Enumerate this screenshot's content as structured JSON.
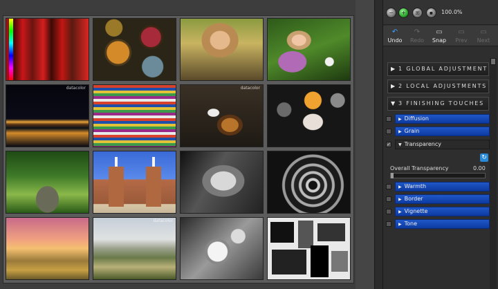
{
  "zoom": {
    "level": "100.0%"
  },
  "toolbar": {
    "undo": "Undo",
    "redo": "Redo",
    "snap": "Snap",
    "prev": "Prev",
    "next": "Next"
  },
  "sections": {
    "global": {
      "number": "1",
      "title": "GLOBAL ADJUSTMENT"
    },
    "local": {
      "number": "2",
      "title": "LOCAL ADJUSTMENTS"
    },
    "finishing": {
      "number": "3",
      "title": "FINISHING TOUCHES"
    }
  },
  "finishing_items": {
    "diffusion": "Diffusion",
    "grain": "Grain",
    "transparency": "Transparency",
    "warmth": "Warmth",
    "border": "Border",
    "vignette": "Vignette",
    "tone": "Tone"
  },
  "transparency": {
    "label": "Overall Transparency",
    "value": "0.00",
    "level": 0.0
  },
  "watermark": "datacolor",
  "colors": {
    "accent_blue": "#1f57c8",
    "zoom_active": "#2aa62a",
    "panel_bg": "#2e2e2e"
  }
}
